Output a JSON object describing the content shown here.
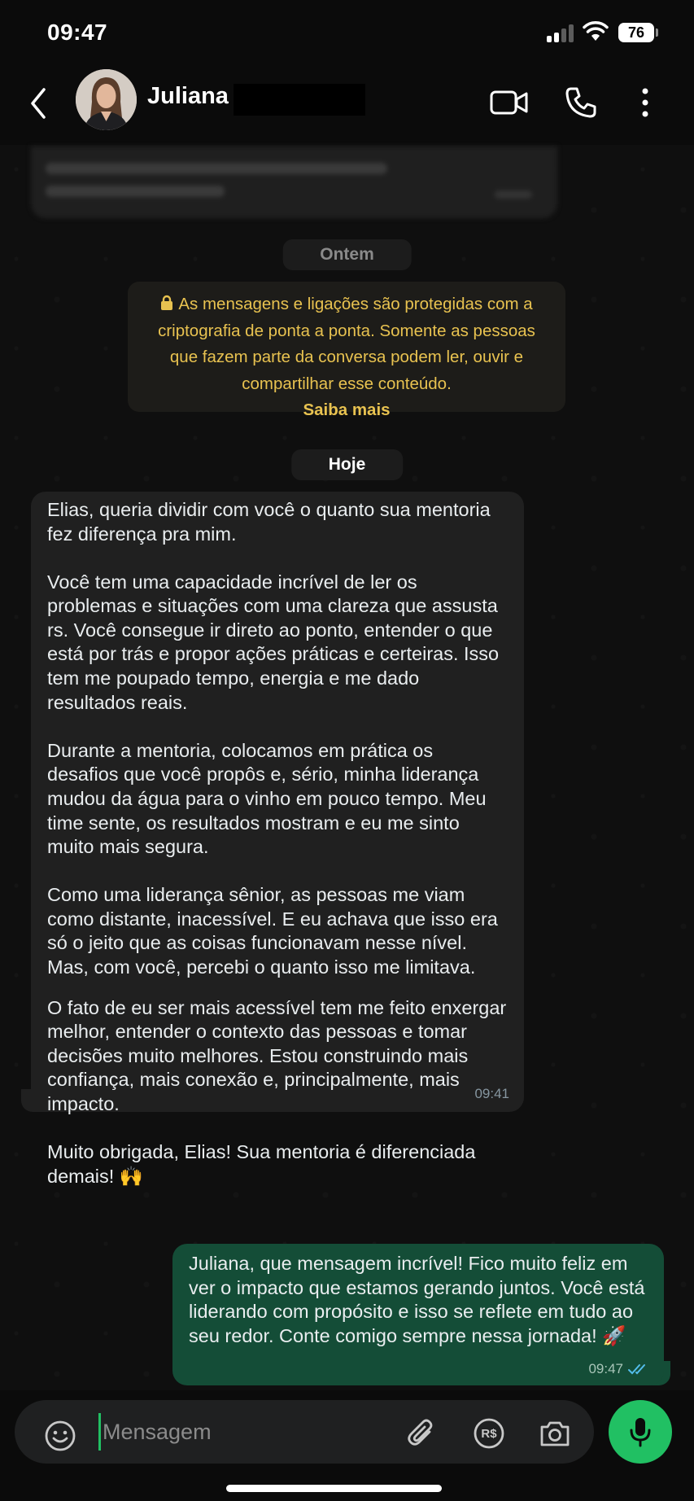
{
  "status_bar": {
    "time": "09:47",
    "battery": "76"
  },
  "header": {
    "contact_name": "Juliana"
  },
  "chat": {
    "date_yesterday": "Ontem",
    "encryption_notice": "As mensagens e ligações são protegidas com a criptografia de ponta a ponta. Somente as pessoas que fazem parte da conversa podem ler, ouvir e compartilhar esse conteúdo.",
    "encryption_learn_more": "Saiba mais",
    "date_today": "Hoje",
    "incoming": {
      "paragraphs": [
        "Elias, queria dividir com você o quanto sua mentoria fez diferença pra mim.",
        "Você tem uma capacidade incrível de ler os problemas e situações com uma clareza que assusta rs. Você consegue ir direto ao ponto, entender o que está por trás e propor ações práticas e certeiras. Isso tem me poupado tempo, energia e me dado resultados reais.",
        "Durante a mentoria, colocamos em prática os desafios que você propôs e, sério, minha liderança mudou da água para o vinho em pouco tempo. Meu time sente, os resultados mostram e eu me sinto muito mais segura.",
        "Como uma liderança sênior, as pessoas me viam como distante, inacessível. E eu achava que isso era só o jeito que as coisas funcionavam nesse nível. Mas, com você, percebi o quanto isso me limitava.",
        "O fato de eu ser mais acessível tem me feito enxergar melhor, entender o contexto das pessoas e tomar decisões muito melhores. Estou construindo mais confiança, mais conexão e, principalmente, mais impacto.",
        "Muito obrigada, Elias! Sua mentoria é diferenciada demais! 🙌"
      ],
      "time": "09:41"
    },
    "outgoing": {
      "text": "Juliana, que mensagem incrível! Fico muito feliz em ver o impacto que estamos gerando juntos. Você está liderando com propósito e isso se reflete em tudo ao seu redor. Conte comigo sempre nessa jornada! 🚀",
      "time": "09:47"
    }
  },
  "composer": {
    "placeholder": "Mensagem",
    "pix_label": "R$"
  },
  "colors": {
    "accent_green": "#21c063",
    "outgoing_bubble": "#144d37",
    "incoming_bubble": "#202020",
    "notice_text": "#e8c250"
  },
  "icons": [
    "back-icon",
    "video-call-icon",
    "phone-icon",
    "more-icon",
    "lock-icon",
    "emoji-icon",
    "attach-icon",
    "pix-icon",
    "camera-icon",
    "mic-icon",
    "double-check-icon"
  ]
}
